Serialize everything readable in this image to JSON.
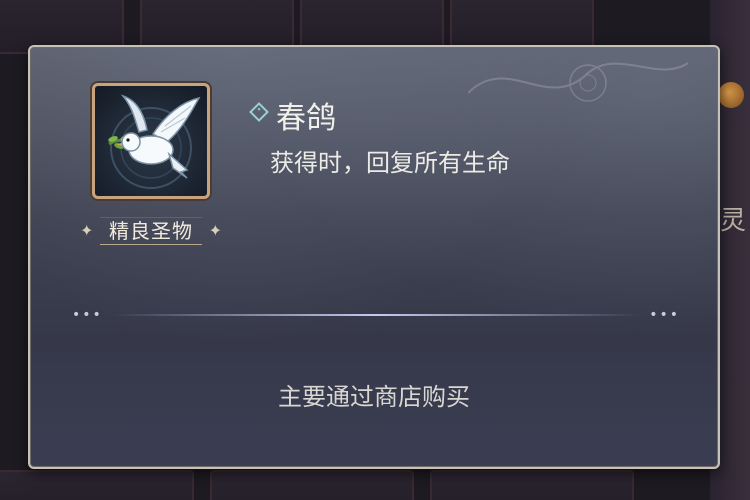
{
  "item": {
    "name": "春鸽",
    "effect": "获得时，回复所有生命",
    "rarity": "精良圣物",
    "icon": "white-dove-with-olive-branch"
  },
  "source": {
    "text": "主要通过商店购买"
  },
  "background": {
    "edge_glyph": "灵"
  },
  "colors": {
    "frame_border": "#c9a27e",
    "title_marker": "#9ad1cf",
    "panel_border": "#c7c2b9"
  }
}
